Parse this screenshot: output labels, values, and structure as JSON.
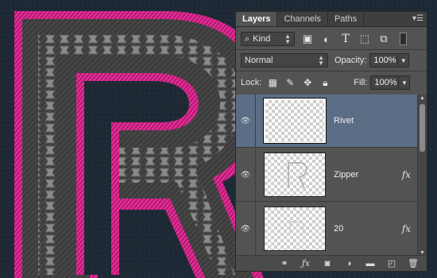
{
  "panel": {
    "tabs": [
      {
        "label": "Layers",
        "active": true
      },
      {
        "label": "Channels",
        "active": false
      },
      {
        "label": "Paths",
        "active": false
      }
    ],
    "filter": {
      "kind_label": "Kind"
    },
    "blend": {
      "mode": "Normal",
      "opacity_label": "Opacity:",
      "opacity": "100%"
    },
    "lock": {
      "label": "Lock:",
      "fill_label": "Fill:",
      "fill": "100%"
    },
    "layers": [
      {
        "name": "Rivet",
        "selected": true,
        "fx": false
      },
      {
        "name": "Zipper",
        "selected": false,
        "fx": true
      },
      {
        "name": "20",
        "selected": false,
        "fx": true
      }
    ],
    "fx_symbol": "fx"
  },
  "colors": {
    "background": "#1f2a35",
    "letter_stroke": "#d21c8c",
    "selection": "#5b6e85"
  }
}
